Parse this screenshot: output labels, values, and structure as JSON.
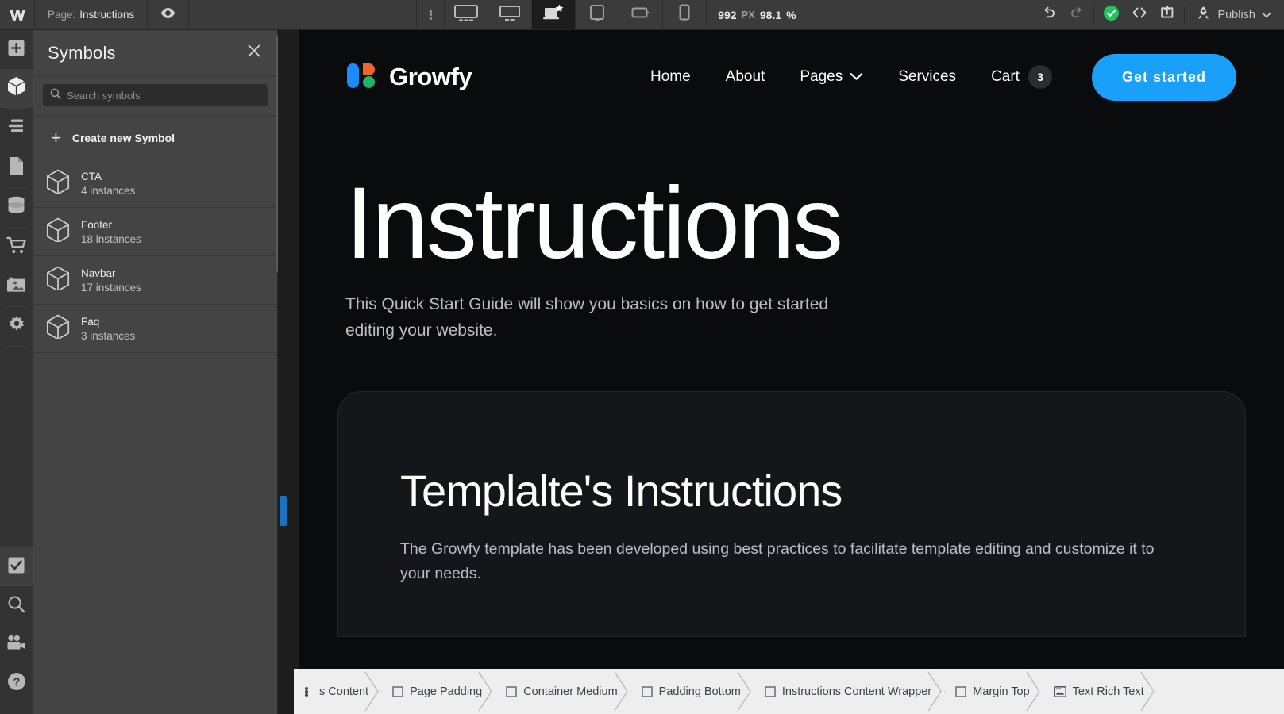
{
  "topbar": {
    "logo_icon": "webflow-logo-icon",
    "page_label": "Page:",
    "page_name": "Instructions",
    "preview_icon": "eye-preview-icon",
    "more_icon": "more-vertical-icon",
    "breakpoints": [
      {
        "name": "breakpoint-desktop-xl",
        "icon": "monitor-large-icon",
        "active": false
      },
      {
        "name": "breakpoint-desktop",
        "icon": "monitor-icon",
        "active": false
      },
      {
        "name": "breakpoint-base",
        "icon": "laptop-star-icon",
        "active": true
      },
      {
        "name": "breakpoint-tablet",
        "icon": "tablet-icon",
        "active": false
      },
      {
        "name": "breakpoint-mobile-landscape",
        "icon": "mobile-landscape-icon",
        "active": false
      },
      {
        "name": "breakpoint-mobile-portrait",
        "icon": "mobile-portrait-icon",
        "active": false
      }
    ],
    "viewport_width": "992",
    "viewport_unit": "PX",
    "zoom_value": "98.1",
    "zoom_unit": "%",
    "undo_icon": "undo-icon",
    "redo_icon": "redo-icon",
    "saved_icon": "saved-check-icon",
    "saved_color": "#21c55d",
    "code_icon": "code-brackets-icon",
    "export_icon": "export-share-icon",
    "rocket_icon": "rocket-icon",
    "publish_label": "Publish",
    "publish_chevron_icon": "chevron-down-icon"
  },
  "rail": {
    "top_items": [
      {
        "name": "rail-add",
        "icon": "plus-square-icon",
        "selected": false
      },
      {
        "name": "rail-symbols",
        "icon": "cube-symbols-icon",
        "selected": true
      },
      {
        "name": "rail-navigator",
        "icon": "navigator-layers-icon",
        "selected": false
      },
      {
        "name": "rail-pages",
        "icon": "page-document-icon",
        "selected": false
      },
      {
        "name": "rail-cms",
        "icon": "database-cms-icon",
        "selected": false
      },
      {
        "name": "rail-ecommerce",
        "icon": "shopping-cart-icon",
        "selected": false
      },
      {
        "name": "rail-assets",
        "icon": "images-assets-icon",
        "selected": false
      },
      {
        "name": "rail-settings",
        "icon": "gear-settings-icon",
        "selected": false
      }
    ],
    "bottom_items": [
      {
        "name": "rail-audit",
        "icon": "checkbox-audit-icon",
        "selected": true
      },
      {
        "name": "rail-search",
        "icon": "search-magnifier-icon",
        "selected": false
      },
      {
        "name": "rail-video",
        "icon": "video-camera-icon",
        "selected": false
      },
      {
        "name": "rail-help",
        "icon": "question-help-icon",
        "selected": false
      }
    ]
  },
  "panel": {
    "title": "Symbols",
    "close_icon": "close-x-icon",
    "search": {
      "icon": "search-magnifier-icon",
      "placeholder": "Search symbols",
      "value": ""
    },
    "create_label": "Create new Symbol",
    "create_icon": "plus-icon",
    "symbols": [
      {
        "icon": "cube-symbol-icon",
        "name": "CTA",
        "instances": "4 instances"
      },
      {
        "icon": "cube-symbol-icon",
        "name": "Footer",
        "instances": "18 instances"
      },
      {
        "icon": "cube-symbol-icon",
        "name": "Navbar",
        "instances": "17 instances"
      },
      {
        "icon": "cube-symbol-icon",
        "name": "Faq",
        "instances": "3 instances"
      }
    ]
  },
  "site": {
    "brand": {
      "name": "Growfy",
      "logo_icon": "growfy-logo-icon",
      "logo_colors": {
        "blue": "#1a8cff",
        "orange": "#f2642a",
        "green": "#17b866"
      }
    },
    "nav": [
      {
        "label": "Home",
        "has_dropdown": false
      },
      {
        "label": "About",
        "has_dropdown": false
      },
      {
        "label": "Pages",
        "has_dropdown": true
      },
      {
        "label": "Services",
        "has_dropdown": false
      }
    ],
    "cart": {
      "label": "Cart",
      "count": "3"
    },
    "cta": {
      "label": "Get started",
      "color": "#18a0fb"
    },
    "hero": {
      "title": "Instructions",
      "subtitle": "This Quick Start Guide will show you basics on how to get started editing your website."
    },
    "card": {
      "title": "Templalte's Instructions",
      "body": "The Growfy template has been developed using best practices to facilitate template editing and customize it to your needs."
    }
  },
  "breadcrumb": {
    "more_icon": "more-horizontal-icon",
    "items": [
      {
        "label": "s Content",
        "icon": "none",
        "truncated": true
      },
      {
        "label": "Page Padding",
        "icon": "block-square-icon"
      },
      {
        "label": "Container Medium",
        "icon": "block-square-icon"
      },
      {
        "label": "Padding Bottom",
        "icon": "block-square-icon"
      },
      {
        "label": "Instructions Content Wrapper",
        "icon": "block-square-icon"
      },
      {
        "label": "Margin Top",
        "icon": "block-square-icon"
      },
      {
        "label": "Text Rich Text",
        "icon": "rich-text-icon"
      }
    ]
  }
}
